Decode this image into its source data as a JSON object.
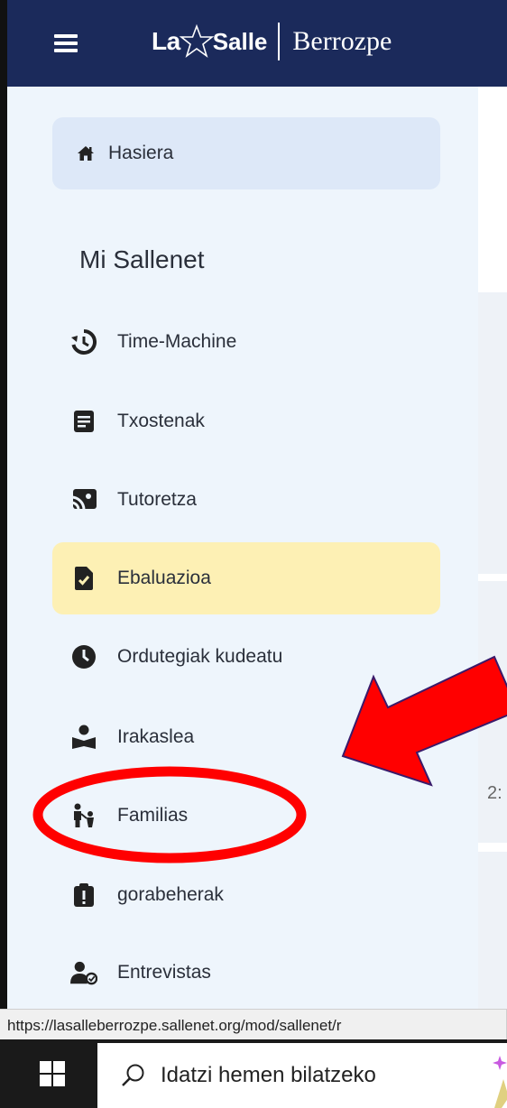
{
  "header": {
    "logo_la": "La",
    "logo_salle": "Salle",
    "logo_school": "Berrozpe",
    "menu_icon": "hamburger-icon"
  },
  "sidebar": {
    "home": {
      "label": "Hasiera",
      "icon": "home-icon"
    },
    "section_title": "Mi Sallenet",
    "items": [
      {
        "label": "Time-Machine",
        "icon": "history-icon"
      },
      {
        "label": "Txostenak",
        "icon": "report-icon"
      },
      {
        "label": "Tutoretza",
        "icon": "tutoring-icon"
      },
      {
        "label": "Ebaluazioa",
        "icon": "evaluation-file-icon",
        "active": true
      },
      {
        "label": "Ordutegiak kudeatu",
        "icon": "clock-icon"
      },
      {
        "label": "Irakaslea",
        "icon": "teacher-icon"
      },
      {
        "label": "Familias",
        "icon": "family-icon"
      },
      {
        "label": "gorabeherak",
        "icon": "incident-icon"
      },
      {
        "label": "Entrevistas",
        "icon": "interview-icon"
      }
    ],
    "active_color": "#fdf0b4",
    "home_color": "#dde8f8"
  },
  "content_clip": "2:",
  "status_url": "https://lasalleberrozpe.sallenet.org/mod/sallenet/r",
  "taskbar": {
    "search_placeholder": "Idatzi hemen bilatzeko",
    "start_icon": "windows-start-icon",
    "search_icon": "search-icon"
  },
  "annotation_color": "#ff0000"
}
